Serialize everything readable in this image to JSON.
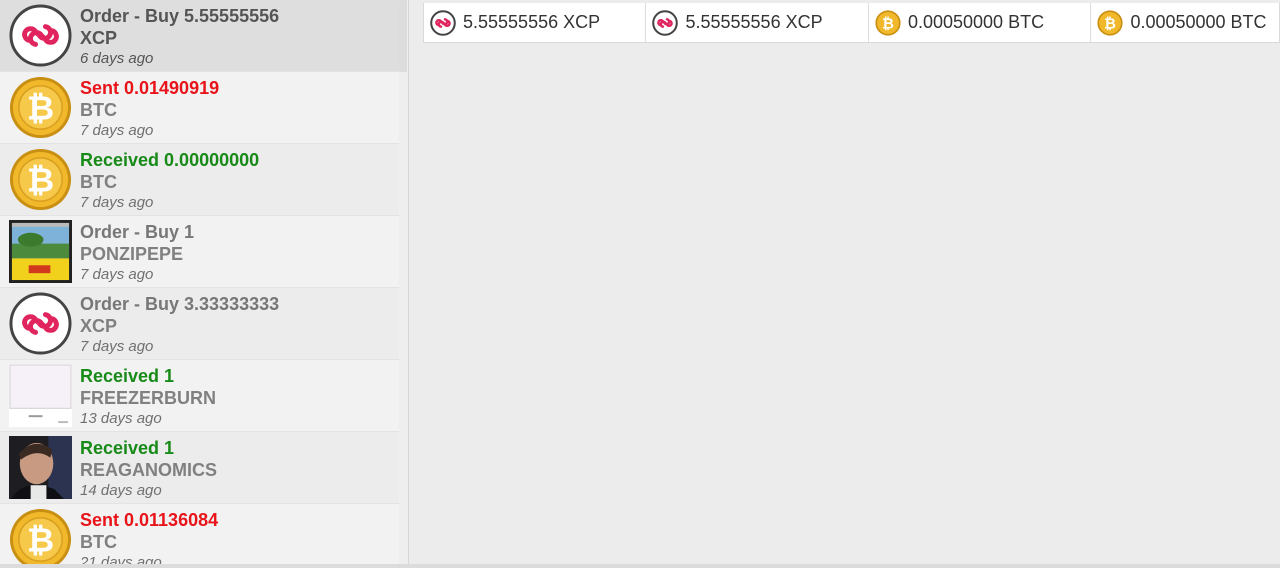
{
  "transactions": [
    {
      "title": "Order - Buy 5.55555556",
      "asset": "XCP",
      "time": "6 days ago",
      "kind": "order",
      "icon": "xcp-icon"
    },
    {
      "title": "Sent 0.01490919",
      "asset": "BTC",
      "time": "7 days ago",
      "kind": "sent",
      "icon": "bitcoin-icon"
    },
    {
      "title": "Received 0.00000000",
      "asset": "BTC",
      "time": "7 days ago",
      "kind": "received",
      "icon": "bitcoin-icon"
    },
    {
      "title": "Order - Buy 1",
      "asset": "PONZIPEPE",
      "time": "7 days ago",
      "kind": "order",
      "icon": "ponzipepe-card-icon"
    },
    {
      "title": "Order - Buy 3.33333333",
      "asset": "XCP",
      "time": "7 days ago",
      "kind": "order",
      "icon": "xcp-icon"
    },
    {
      "title": "Received 1",
      "asset": "FREEZERBURN",
      "time": "13 days ago",
      "kind": "received",
      "icon": "freezerburn-card-icon"
    },
    {
      "title": "Received 1",
      "asset": "REAGANOMICS",
      "time": "14 days ago",
      "kind": "received",
      "icon": "reaganomics-portrait-icon"
    },
    {
      "title": "Sent 0.01136084",
      "asset": "BTC",
      "time": "21 days ago",
      "kind": "sent",
      "icon": "bitcoin-icon"
    }
  ],
  "detail": {
    "cells": [
      {
        "text": "5.55555556 XCP",
        "icon": "xcp-icon"
      },
      {
        "text": "5.55555556 XCP",
        "icon": "xcp-icon"
      },
      {
        "text": "0.00050000 BTC",
        "icon": "bitcoin-icon"
      },
      {
        "text": "0.00050000 BTC",
        "icon": "bitcoin-icon"
      }
    ]
  },
  "colors": {
    "sent": "#e8141a",
    "received": "#178a17",
    "order": "#777777",
    "xcp_red": "#e0245e",
    "btc_gold": "#f0b82a"
  }
}
